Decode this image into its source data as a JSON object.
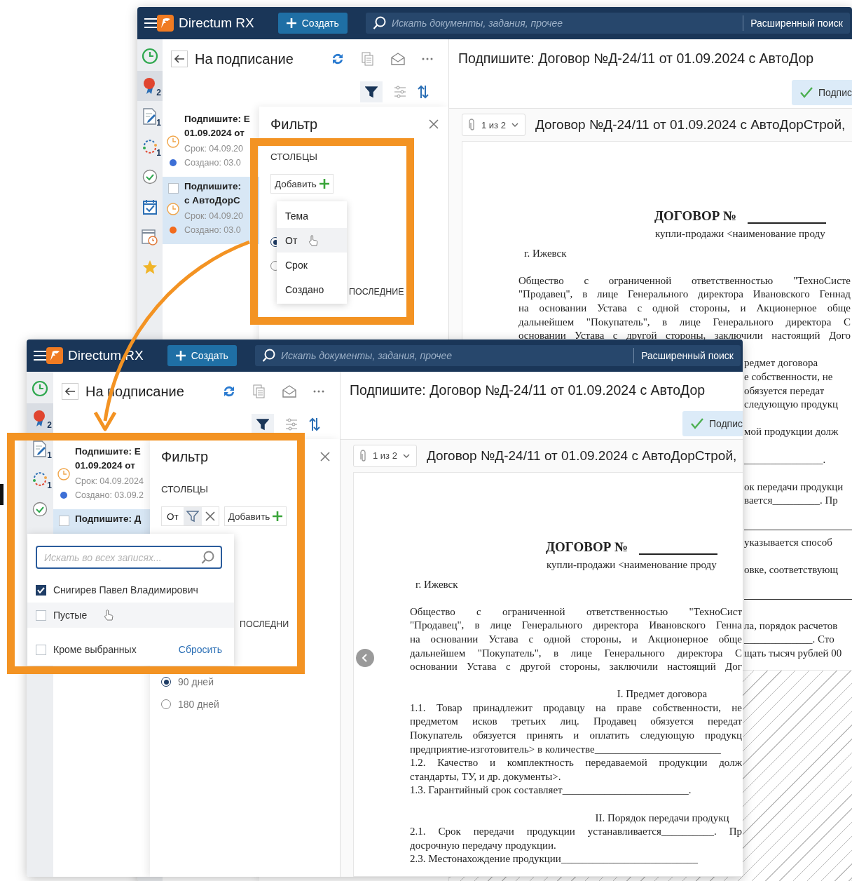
{
  "windows": [
    {
      "top_bar": {
        "app_name": "Directum RX",
        "create_label": "Создать",
        "search_placeholder": "Искать документы, задания, прочее",
        "advanced_search": "Расширенный поиск"
      },
      "rail": [
        {
          "kind": "history",
          "selected": false
        },
        {
          "kind": "award",
          "badge": "2",
          "selected": true
        },
        {
          "kind": "sign-doc",
          "badge": "1",
          "selected": false
        },
        {
          "kind": "cycle",
          "badge": "1",
          "selected": false
        },
        {
          "kind": "done",
          "selected": false
        },
        {
          "kind": "calendar-check",
          "selected": false
        },
        {
          "kind": "calendar-clock",
          "selected": false
        },
        {
          "kind": "star",
          "selected": false
        }
      ],
      "list": {
        "title": "На подписание",
        "items": [
          {
            "lines": [
              "Подпишите: Е",
              "01.09.2024 от"
            ],
            "due": "Срок: 04.09.20",
            "created": "Создано: 03.0",
            "color": "#3d6fd6",
            "selected": false
          },
          {
            "lines": [
              "Подпишите:",
              "с АвтоДорС"
            ],
            "due": "Срок: 04.09.20",
            "created": "Создано: 03.0",
            "color": "#f26b1d",
            "selected": true
          }
        ]
      },
      "filter": {
        "title": "Фильтр",
        "section": "СТОЛБЦЫ",
        "add_label": "Добавить",
        "menu": [
          {
            "label": "Тема",
            "hovered": false
          },
          {
            "label": "От",
            "hovered": true
          },
          {
            "label": "Срок",
            "hovered": false
          },
          {
            "label": "Создано",
            "hovered": false
          }
        ],
        "state_radios": [
          {
            "selected": true
          },
          {
            "selected": false
          }
        ],
        "period_label": "ПОСЛЕДНИЕ"
      },
      "doc": {
        "title": "Подпишите: Договор №Д-24/11 от 01.09.2024 с АвтоДор",
        "sign_label": "Подпис",
        "attachment_counter": "1 из 2",
        "attachment_name": "Договор №Д-24/11 от 01.09.2024 с АвтоДорСтрой,",
        "lines": [
          {
            "kind": "heading",
            "text": "ДОГОВОР №"
          },
          {
            "kind": "subtitle",
            "text": "купли-продажи <наименование проду"
          },
          {
            "kind": "city",
            "text": "г. Ижевск"
          },
          {
            "kind": "gap"
          },
          {
            "kind": "justify",
            "text": "Общество с ограниченной ответственностью \"ТехноСисте"
          },
          {
            "kind": "justify",
            "text": "\"Продавец\", в лице Генерального директора Ивановского Геннад"
          },
          {
            "kind": "justify",
            "text": "на основании Устава с одной стороны, и Акционерное обще"
          },
          {
            "kind": "justify",
            "text": "дальнейшем \"Покупатель\", в лице Генерального директора С"
          },
          {
            "kind": "justify",
            "text": "основании Устава с другой стороны, заключили настоящий Дого"
          },
          {
            "kind": "gap"
          },
          {
            "kind": "strip",
            "text": "редмет договора"
          },
          {
            "kind": "strip",
            "text": "е собственности, не"
          },
          {
            "kind": "strip",
            "text": "обязуется передат"
          },
          {
            "kind": "strip",
            "text": "следующую продукц"
          },
          {
            "kind": "gap"
          },
          {
            "kind": "strip",
            "text": "мой продукции долж"
          },
          {
            "kind": "gap"
          },
          {
            "kind": "strip",
            "text": "_______________."
          },
          {
            "kind": "gap"
          },
          {
            "kind": "strip",
            "text": "ок передачи продукци"
          },
          {
            "kind": "strip",
            "text": "вается_________. Пр"
          },
          {
            "kind": "gap"
          },
          {
            "kind": "rule"
          },
          {
            "kind": "strip",
            "text": "указывается способ"
          },
          {
            "kind": "gap"
          },
          {
            "kind": "strip",
            "text": "овке, соответствующ"
          },
          {
            "kind": "gap"
          },
          {
            "kind": "rule"
          },
          {
            "kind": "gap"
          },
          {
            "kind": "strip",
            "text": "ла, порядок расчетов"
          },
          {
            "kind": "strip",
            "text": "_____________. Сто"
          },
          {
            "kind": "strip",
            "text": "щать тысяч рублей 00"
          }
        ]
      }
    },
    {
      "top_bar": {
        "app_name": "Directum RX",
        "create_label": "Создать",
        "search_placeholder": "Искать документы, задания, прочее",
        "advanced_search": "Расширенный поиск"
      },
      "rail": [
        {
          "kind": "history",
          "selected": false
        },
        {
          "kind": "award",
          "badge": "2",
          "selected": true
        },
        {
          "kind": "sign-doc",
          "badge": "1",
          "selected": false
        },
        {
          "kind": "cycle",
          "badge": "1",
          "selected": false
        },
        {
          "kind": "done",
          "selected": false
        }
      ],
      "list": {
        "title": "На подписание",
        "items": [
          {
            "lines": [
              "Подпишите: Е",
              "01.09.2024 от"
            ],
            "due": "Срок: 04.09.2024",
            "created": "Создано: 03.09.2",
            "color": "#3d6fd6",
            "selected": false
          },
          {
            "lines": [
              "Подпишите: Д"
            ],
            "selected": true
          }
        ]
      },
      "filter": {
        "title": "Фильтр",
        "section": "СТОЛБЦЫ",
        "chips": [
          {
            "label": "От"
          }
        ],
        "add_label": "Добавить",
        "value_popup": {
          "search_placeholder": "Искать во всех записях...",
          "options": [
            {
              "label": "Снигирев Павел Владимирович",
              "checked": true,
              "hovered": false
            },
            {
              "label": "Пустые",
              "checked": false,
              "hovered": true
            }
          ],
          "except_label": "Кроме выбранных",
          "except_checked": false,
          "reset_label": "Сбросить"
        },
        "period_label": "ПОСЛЕДНИ",
        "period_radios": [
          {
            "label": "90 дней",
            "selected": true
          },
          {
            "label": "180 дней",
            "selected": false
          }
        ]
      },
      "doc": {
        "title": "Подпишите: Договор №Д-24/11 от 01.09.2024 с АвтоДор",
        "sign_label": "Подпис",
        "attachment_counter": "1 из 2",
        "attachment_name": "Договор №Д-24/11 от 01.09.2024 с АвтоДорСтрой,",
        "lines": [
          {
            "kind": "heading",
            "text": "ДОГОВОР №"
          },
          {
            "kind": "subtitle",
            "text": "купли-продажи <наименование проду"
          },
          {
            "kind": "city",
            "text": "г. Ижевск"
          },
          {
            "kind": "gap"
          },
          {
            "kind": "justify",
            "text": "Общество с ограниченной ответственностью \"ТехноСист"
          },
          {
            "kind": "justify",
            "text": "\"Продавец\", в лице Генерального директора Ивановского Генна"
          },
          {
            "kind": "justify",
            "text": "на основании Устава с одной стороны, и Акционерное обще"
          },
          {
            "kind": "justify",
            "text": "дальнейшем \"Покупатель\", в лице Генерального директора С"
          },
          {
            "kind": "justify",
            "text": "основании Устава с другой стороны, заключили настоящий Дог"
          },
          {
            "kind": "gap"
          },
          {
            "kind": "section",
            "text": "I. Предмет договора"
          },
          {
            "kind": "justify",
            "text": "1.1. Товар принадлежит продавцу на праве собственности, не"
          },
          {
            "kind": "justify",
            "text": "предметом исков третьих лиц. Продавец обязуется передат"
          },
          {
            "kind": "justify",
            "text": "Покупатель обязуется принять и оплатить следующую продукц"
          },
          {
            "kind": "text",
            "text": "предприятие-изготовитель> в количестве________________________"
          },
          {
            "kind": "justify",
            "text": "1.2. Качество и комплектность передаваемой продукции долж"
          },
          {
            "kind": "text",
            "text": "стандарты, ТУ, и др. документы>."
          },
          {
            "kind": "text",
            "text": "1.3. Гарантийный срок составляет________________________."
          },
          {
            "kind": "gap"
          },
          {
            "kind": "section",
            "text": "II. Порядок передачи продукц"
          },
          {
            "kind": "justify",
            "text": "2.1. Срок передачи продукции устанавливается__________. Пр"
          },
          {
            "kind": "text",
            "text": "досрочную передачу продукции."
          },
          {
            "kind": "text",
            "text": "2.3. Местонахождение продукции__________________________"
          }
        ]
      }
    }
  ]
}
